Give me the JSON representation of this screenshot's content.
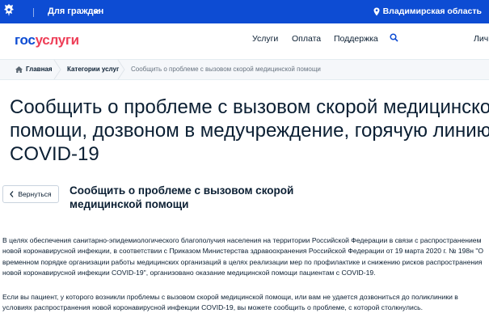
{
  "topbar": {
    "for_citizens": "Для граждан",
    "region": "Владимирская область"
  },
  "header": {
    "logo_part1": "гос",
    "logo_part2": "услуги",
    "nav": [
      "Услуги",
      "Оплата",
      "Поддержка"
    ],
    "cabinet": "Личн"
  },
  "breadcrumbs": {
    "home": "Главная",
    "category": "Категории услуг",
    "current": "Сообщить о проблеме с вызовом скорой медицинской помощи"
  },
  "page": {
    "title_lines": [
      "Сообщить о проблеме с вызовом скорой медицинской",
      "помощи, дозвоном в медучреждение, горячую линию",
      "COVID-19"
    ],
    "back_label": "Вернуться",
    "subtitle": "Сообщить о проблеме с вызовом скорой медицинской помощи",
    "paragraphs": [
      "В целях обеспечения санитарно-эпидемиологического благополучия населения на территории Российской Федерации в связи с распространением новой коронавирусной инфекции, в соответствии с Приказом Министерства здравоохранения Российской Федерации от 19 марта 2020 г. № 198н \"О временном порядке организации работы медицинских организаций в целях реализации мер по профилактике и снижению рисков распространения новой коронавирусной инфекции COVID-19\", организовано оказание медицинской помощи пациентам с COVID-19.",
      "Если вы пациент, у которого возникли проблемы с вызовом скорой медицинской помощи, или вам не удается дозвониться до поликлиники в условиях распространения новой коронавирусной инфекции COVID-19, вы можете сообщить о проблеме, с которой столкнулись."
    ]
  },
  "colors": {
    "brand_blue": "#0d4cd3",
    "brand_red": "#ee3f58",
    "text": "#0b1f33"
  },
  "icons": [
    "coat-of-arms-icon",
    "chevron-down-icon",
    "location-pin-icon",
    "search-icon",
    "home-icon",
    "chevron-left-icon"
  ]
}
